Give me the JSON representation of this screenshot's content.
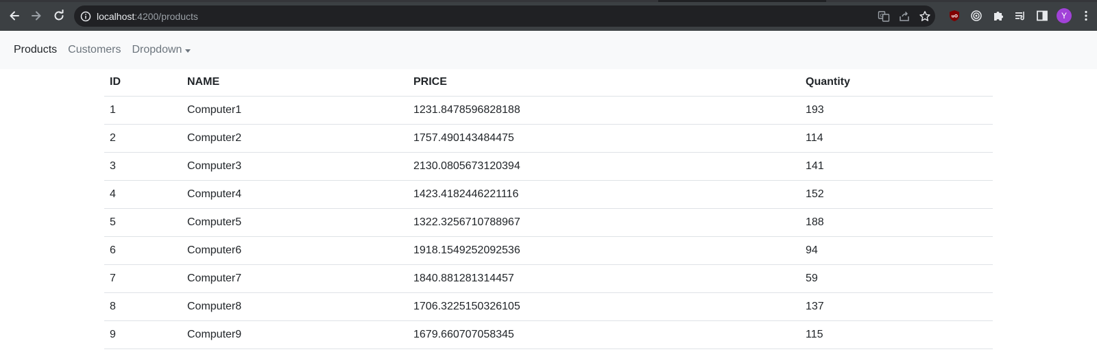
{
  "browser": {
    "url_host": "localhost",
    "url_rest": ":4200/products",
    "profile_initial": "Y",
    "icons": [
      "back-icon",
      "forward-icon",
      "reload-icon",
      "info-icon",
      "translate-icon",
      "share-icon",
      "bookmark-star-icon",
      "ublock-icon",
      "target-extension-icon",
      "extensions-puzzle-icon",
      "reading-list-icon",
      "side-panel-icon",
      "menu-kebab-icon"
    ],
    "colors": {
      "toolbar": "#3c4043",
      "omnibox": "#202124",
      "avatar": "#a142d8"
    }
  },
  "navbar": {
    "items": [
      {
        "label": "Products",
        "active": true
      },
      {
        "label": "Customers",
        "active": false
      },
      {
        "label": "Dropdown",
        "active": false
      }
    ]
  },
  "table": {
    "headers": [
      "ID",
      "NAME",
      "PRICE",
      "Quantity"
    ],
    "rows": [
      [
        "1",
        "Computer1",
        "1231.8478596828188",
        "193"
      ],
      [
        "2",
        "Computer2",
        "1757.490143484475",
        "114"
      ],
      [
        "3",
        "Computer3",
        "2130.0805673120394",
        "141"
      ],
      [
        "4",
        "Computer4",
        "1423.4182446221116",
        "152"
      ],
      [
        "5",
        "Computer5",
        "1322.3256710788967",
        "188"
      ],
      [
        "6",
        "Computer6",
        "1918.1549252092536",
        "94"
      ],
      [
        "7",
        "Computer7",
        "1840.881281314457",
        "59"
      ],
      [
        "8",
        "Computer8",
        "1706.3225150326105",
        "137"
      ],
      [
        "9",
        "Computer9",
        "1679.660707058345",
        "115"
      ]
    ]
  }
}
